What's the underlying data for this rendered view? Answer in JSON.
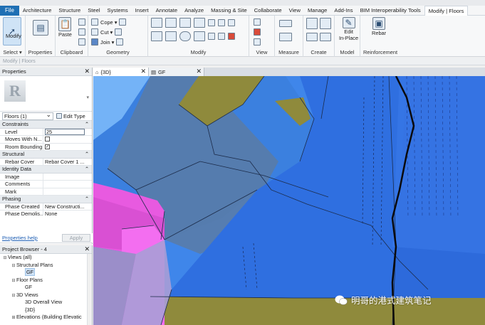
{
  "menubar": {
    "tabs": [
      "File",
      "Architecture",
      "Structure",
      "Steel",
      "Systems",
      "Insert",
      "Annotate",
      "Analyze",
      "Massing & Site",
      "Collaborate",
      "View",
      "Manage",
      "Add-Ins",
      "BIM Interoperability Tools",
      "Modify | Floors"
    ],
    "active_tab": "Modify | Floors"
  },
  "ribbon": {
    "select": {
      "big": "Modify",
      "label": "Select ▾"
    },
    "properties": {
      "label": "Properties"
    },
    "clipboard": {
      "paste": "Paste",
      "label": "Clipboard"
    },
    "geometry": {
      "cope": "Cope ▾",
      "cut": "Cut ▾",
      "join": "Join ▾",
      "label": "Geometry"
    },
    "modify": {
      "label": "Modify"
    },
    "view": {
      "label": "View"
    },
    "measure": {
      "label": "Measure"
    },
    "create": {
      "label": "Create"
    },
    "model": {
      "btn1": "Edit",
      "btn2": "In-Place",
      "label": "Model"
    },
    "reinforcement": {
      "btn": "Rebar",
      "label": "Reinforcement"
    }
  },
  "context_bar": "Modify | Floors",
  "properties": {
    "title": "Properties",
    "type_selector": "Floors (1)",
    "edit_type": "Edit Type",
    "sections": [
      {
        "name": "Constraints",
        "rows": [
          {
            "key": "Level",
            "value": "25",
            "kind": "input"
          },
          {
            "key": "Moves With N...",
            "value": "",
            "kind": "checkbox",
            "checked": false
          },
          {
            "key": "Room Bounding",
            "value": "",
            "kind": "checkbox",
            "checked": true
          }
        ]
      },
      {
        "name": "Structural",
        "rows": [
          {
            "key": "Rebar Cover",
            "value": "Rebar Cover 1 ...",
            "kind": "text"
          }
        ]
      },
      {
        "name": "Identity Data",
        "rows": [
          {
            "key": "Image",
            "value": "",
            "kind": "text"
          },
          {
            "key": "Comments",
            "value": "",
            "kind": "text"
          },
          {
            "key": "Mark",
            "value": "",
            "kind": "text"
          }
        ]
      },
      {
        "name": "Phasing",
        "rows": [
          {
            "key": "Phase Created",
            "value": "New Constructi...",
            "kind": "text"
          },
          {
            "key": "Phase Demolis...",
            "value": "None",
            "kind": "text"
          }
        ]
      }
    ],
    "help_link": "Properties help",
    "apply": "Apply"
  },
  "project_browser": {
    "title": "Project Browser - 4",
    "items": [
      {
        "label": "Views (all)",
        "level": 0,
        "toggle": "⊟"
      },
      {
        "label": "Structural Plans",
        "level": 1,
        "toggle": "⊟"
      },
      {
        "label": "GF",
        "level": 2,
        "toggle": "",
        "selected": true
      },
      {
        "label": "Floor Plans",
        "level": 1,
        "toggle": "⊟"
      },
      {
        "label": "GF",
        "level": 2,
        "toggle": ""
      },
      {
        "label": "3D Views",
        "level": 1,
        "toggle": "⊟"
      },
      {
        "label": "3D Overall View",
        "level": 2,
        "toggle": ""
      },
      {
        "label": "{3D}",
        "level": 2,
        "toggle": ""
      },
      {
        "label": "Elevations (Building Elevatic",
        "level": 1,
        "toggle": "⊞"
      }
    ]
  },
  "view_tabs": [
    {
      "label": "{3D}",
      "active": true
    },
    {
      "label": "GF",
      "active": false
    }
  ],
  "watermark": "明哥的港式建筑笔记",
  "colors": {
    "accent": "#1f6fb4",
    "slab_blue": "#2f6fe0",
    "olive": "#8f8a3c",
    "magenta": "#e85ae0"
  }
}
